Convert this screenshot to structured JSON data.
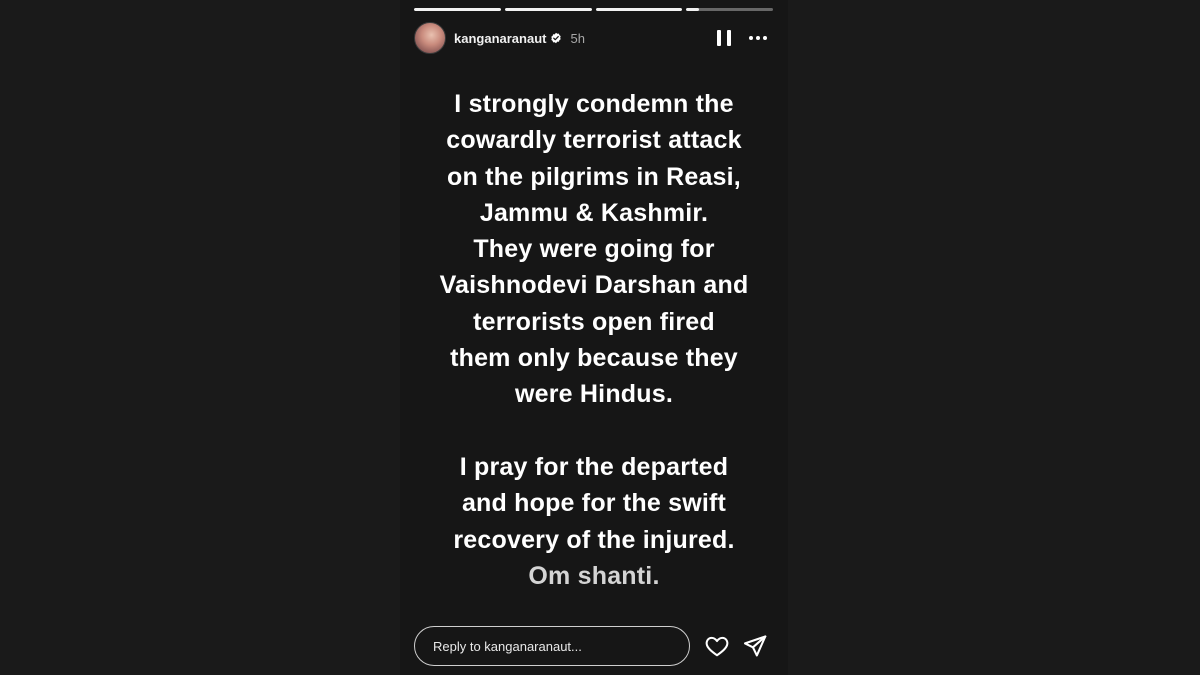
{
  "story": {
    "progress_fills": [
      1.0,
      1.0,
      1.0,
      0.15
    ],
    "username": "kanganaranaut",
    "verified": true,
    "time": "5h",
    "lines": [
      "I strongly condemn the",
      "cowardly terrorist attack",
      "on the pilgrims in Reasi,",
      "Jammu & Kashmir.",
      "They were going for",
      "Vaishnodevi Darshan and",
      "terrorists open fired",
      "them only because they",
      "were Hindus.",
      "",
      "I pray for the departed",
      "and hope for the swift",
      "recovery of the injured.",
      "Om shanti."
    ]
  },
  "footer": {
    "reply_placeholder": "Reply to kanganaranaut..."
  },
  "icons": {
    "pause": "pause-icon",
    "more": "more-options-icon",
    "verified": "verified-badge-icon",
    "heart": "heart-icon",
    "send": "send-icon"
  },
  "colors": {
    "background": "#1a1a1a",
    "story_background": "#161616",
    "text": "#ffffff",
    "muted_text": "#a8a8a8"
  }
}
